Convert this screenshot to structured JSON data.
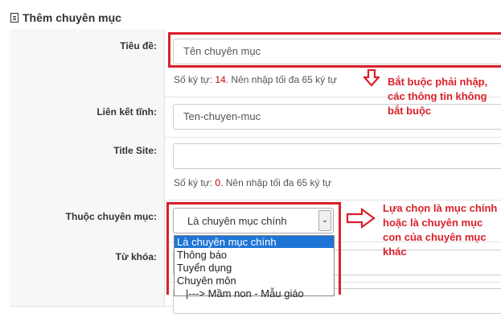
{
  "header": {
    "title": "Thêm chuyên mục"
  },
  "fields": {
    "title": {
      "label": "Tiêu đề:",
      "value": "Tên chuyên mục",
      "hint_prefix": "Số ký tự: ",
      "hint_count": "14",
      "hint_suffix": ". Nên nhập tối đa 65 ký tự"
    },
    "static_link": {
      "label": "Liên kết tĩnh:",
      "value": "Ten-chuyen-muc"
    },
    "title_site": {
      "label": "Title Site:",
      "value": "",
      "hint_prefix": "Số ký tự: ",
      "hint_count": "0",
      "hint_suffix": ". Nên nhập tối đa 65 ký tự"
    },
    "parent_category": {
      "label": "Thuộc chuyên mục:",
      "selected": "Là chuyên mục chính",
      "options": [
        "Là chuyên mục chính",
        "Thông báo",
        "Tuyển dụng",
        "Chuyên môn",
        "|---> Mầm non - Mẫu giáo"
      ]
    },
    "keywords": {
      "label": "Từ khóa:"
    }
  },
  "annotations": {
    "required": [
      "Bắt buộc phải nhập,",
      "các thông tin không",
      "bắt buộc"
    ],
    "choose": [
      "Lựa chọn là mục chính",
      "hoặc là chuyên mục",
      "con của chuyên mục",
      "khác"
    ]
  },
  "colors": {
    "annotation": "#d9202a",
    "selected_option": "#1e74d6",
    "count": "#cc0000"
  }
}
